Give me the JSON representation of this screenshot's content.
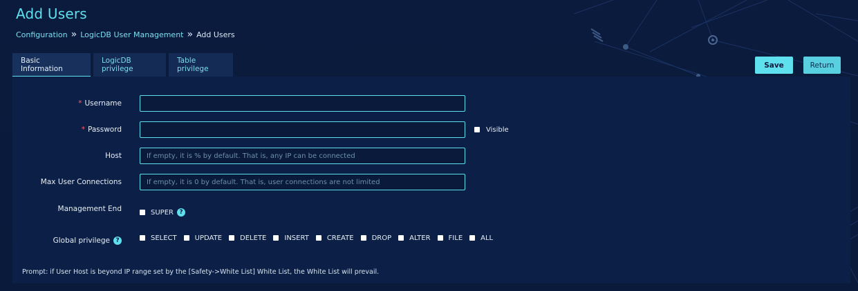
{
  "page": {
    "title": "Add Users"
  },
  "breadcrumb": {
    "items": [
      "Configuration",
      "LogicDB User Management",
      "Add Users"
    ],
    "separator": "»"
  },
  "tabs": [
    {
      "label": "Basic Information",
      "active": true
    },
    {
      "label": "LogicDB privilege",
      "active": false
    },
    {
      "label": "Table privilege",
      "active": false
    }
  ],
  "toolbar": {
    "save_label": "Save",
    "return_label": "Return"
  },
  "form": {
    "required_mark": "*",
    "username": {
      "label": "Username",
      "value": "",
      "placeholder": ""
    },
    "password": {
      "label": "Password",
      "value": "",
      "placeholder": "",
      "visible_label": "Visible"
    },
    "host": {
      "label": "Host",
      "value": "",
      "placeholder": "If empty, it is % by default. That is, any IP can be connected"
    },
    "max_connections": {
      "label": "Max User Connections",
      "value": "",
      "placeholder": "If empty, it is 0 by default. That is, user connections are not limited"
    },
    "management_end": {
      "label": "Management End",
      "option": "SUPER"
    },
    "global_privilege": {
      "label": "Global privilege",
      "options": [
        "SELECT",
        "UPDATE",
        "DELETE",
        "INSERT",
        "CREATE",
        "DROP",
        "ALTER",
        "FILE",
        "ALL"
      ]
    },
    "help_glyph": "?"
  },
  "prompt": "Prompt: if User Host is beyond IP range set by the [Safety->White List] White List, the White List will prevail.",
  "colors": {
    "accent": "#5fe0ee",
    "background": "#0b1b3d",
    "panel": "#0c1f47",
    "required": "#ff5a6a"
  }
}
